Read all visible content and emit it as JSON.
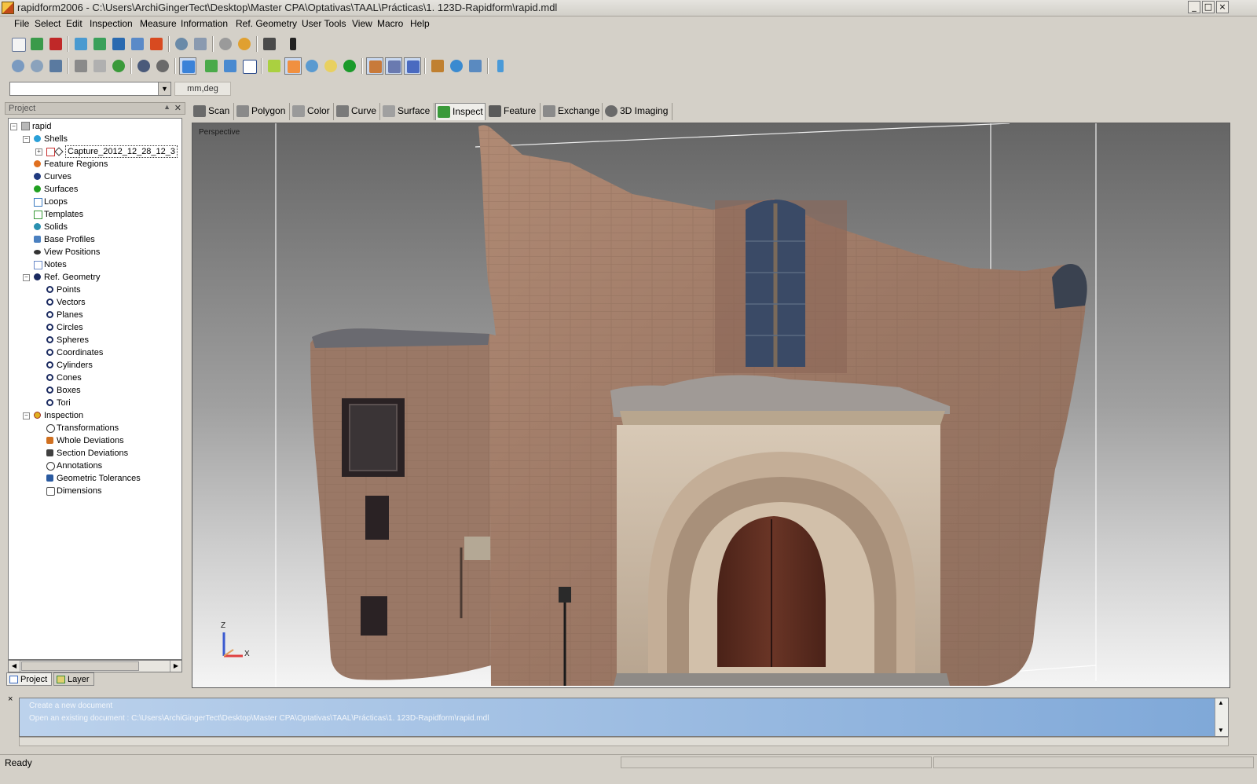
{
  "window": {
    "title": "rapidform2006 - C:\\Users\\ArchiGingerTect\\Desktop\\Master CPA\\Optativas\\TAAL\\Prácticas\\1. 123D-Rapidform\\rapid.mdl",
    "controls": {
      "minimize": "_",
      "maximize": "□",
      "close": "×"
    }
  },
  "menu": [
    "File",
    "Select",
    "Edit",
    "Inspection",
    "Measure",
    "Information",
    "Ref. Geometry",
    "User Tools",
    "View",
    "Macro",
    "Help"
  ],
  "toolbar": {
    "units": "mm,deg",
    "combo_value": ""
  },
  "project_panel": {
    "title": "Project",
    "tree": [
      {
        "label": "rapid",
        "color": "#888888"
      },
      {
        "label": "Shells",
        "color": "#2aa0d8"
      },
      {
        "label": "Capture_2012_12_28_12_3",
        "color": "#c83030"
      },
      {
        "label": "Feature Regions",
        "color": "#e07020"
      },
      {
        "label": "Curves",
        "color": "#203a80"
      },
      {
        "label": "Surfaces",
        "color": "#20a020"
      },
      {
        "label": "Loops",
        "color": "#3a7ac0"
      },
      {
        "label": "Templates",
        "color": "#3a9a3a"
      },
      {
        "label": "Solids",
        "color": "#2a90b0"
      },
      {
        "label": "Base Profiles",
        "color": "#4a80c0"
      },
      {
        "label": "View Positions",
        "color": "#333333"
      },
      {
        "label": "Notes",
        "color": "#6a8ac8"
      },
      {
        "label": "Ref. Geometry",
        "color": "#1a2a60"
      },
      {
        "label": "Points",
        "color": "#1a2a60"
      },
      {
        "label": "Vectors",
        "color": "#1a2a60"
      },
      {
        "label": "Planes",
        "color": "#1a2a60"
      },
      {
        "label": "Circles",
        "color": "#1a2a60"
      },
      {
        "label": "Spheres",
        "color": "#1a2a60"
      },
      {
        "label": "Coordinates",
        "color": "#1a2a60"
      },
      {
        "label": "Cylinders",
        "color": "#1a2a60"
      },
      {
        "label": "Cones",
        "color": "#1a2a60"
      },
      {
        "label": "Boxes",
        "color": "#1a2a60"
      },
      {
        "label": "Tori",
        "color": "#1a2a60"
      },
      {
        "label": "Inspection",
        "color": "#e0b020"
      },
      {
        "label": "Transformations",
        "color": "#333333"
      },
      {
        "label": "Whole Deviations",
        "color": "#d07020"
      },
      {
        "label": "Section Deviations",
        "color": "#404040"
      },
      {
        "label": "Annotations",
        "color": "#333333"
      },
      {
        "label": "Geometric Tolerances",
        "color": "#2a5aa0"
      },
      {
        "label": "Dimensions",
        "color": "#555555"
      }
    ],
    "tabs": [
      "Project",
      "Layer"
    ]
  },
  "feature_tabs": [
    "Scan",
    "Polygon",
    "Color",
    "Curve",
    "Surface",
    "Inspect",
    "Feature",
    "Exchange",
    "3D Imaging"
  ],
  "viewport": {
    "label": "Perspective",
    "axis_z": "Z",
    "axis_x": "X"
  },
  "log": {
    "close": "×",
    "lines": [
      "Create a new document",
      "Open an existing document : C:\\Users\\ArchiGingerTect\\Desktop\\Master CPA\\Optativas\\TAAL\\Prácticas\\1. 123D-Rapidform\\rapid.mdl"
    ]
  },
  "status": {
    "text": "Ready"
  }
}
